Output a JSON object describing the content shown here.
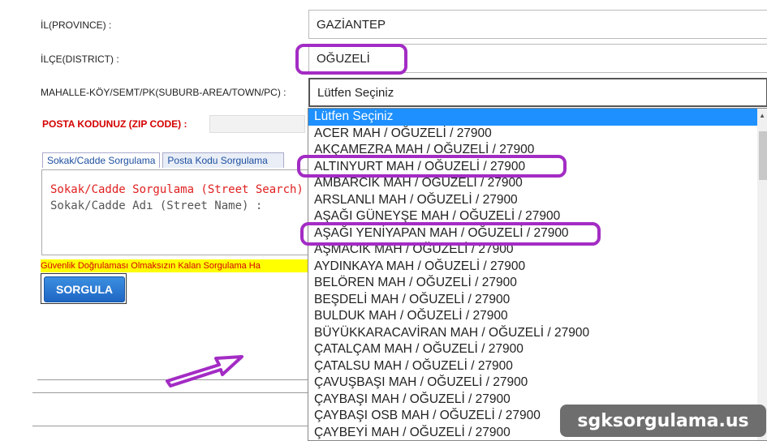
{
  "form": {
    "province_label": "İL(PROVINCE) :",
    "province_value": "GAZİANTEP",
    "district_label": "İLÇE(DISTRICT) :",
    "district_value": "OĞUZELİ",
    "suburb_label": "MAHALLE-KÖY/SEMT/PK(SUBURB-AREA/TOWN/PC) :",
    "suburb_value": "Lütfen Seçiniz",
    "zip_label": "POSTA KODUNUZ (ZIP CODE) :"
  },
  "tabs": [
    {
      "label": "Sokak/Cadde Sorgulama"
    },
    {
      "label": "Posta Kodu Sorgulama"
    }
  ],
  "panel": {
    "title": "Sokak/Cadde Sorgulama (Street Search)",
    "field_label": "Sokak/Cadde Adı (Street Name) :"
  },
  "warning_text": "Güvenlik Doğrulaması Olmaksızın Kalan Sorgulama Ha",
  "button_label": "SORGULA",
  "dropdown": {
    "options": [
      "Lütfen Seçiniz",
      "ACER MAH / OĞUZELİ / 27900",
      "AKÇAMEZRA MAH / OĞUZELİ / 27900",
      "ALTINYURT MAH / OĞUZELİ / 27900",
      "AMBARCIK MAH / OĞUZELİ / 27900",
      "ARSLANLI MAH / OĞUZELİ / 27900",
      "AŞAĞI GÜNEYŞE MAH / OĞUZELİ / 27900",
      "AŞAĞI YENİYAPAN MAH / OĞUZELİ / 27900",
      "AŞMACIK MAH / OĞUZELİ / 27900",
      "AYDINKAYA MAH / OĞUZELİ / 27900",
      "BELÖREN MAH / OĞUZELİ / 27900",
      "BEŞDELİ MAH / OĞUZELİ / 27900",
      "BULDUK MAH / OĞUZELİ / 27900",
      "BÜYÜKKARACAVİRAN MAH / OĞUZELİ / 27900",
      "ÇATALÇAM MAH / OĞUZELİ / 27900",
      "ÇATALSU MAH / OĞUZELİ / 27900",
      "ÇAVUŞBAŞI MAH / OĞUZELİ / 27900",
      "ÇAYBAŞI MAH / OĞUZELİ / 27900",
      "ÇAYBAŞI OSB MAH / OĞUZELİ / 27900",
      "ÇAYBEYİ MAH / OĞUZELİ / 27900"
    ]
  },
  "watermark": "sgksorgulama.us",
  "colors": {
    "highlight": "#a32cc4",
    "selected_option": "#1e90ff",
    "zip_label": "#d40000",
    "warning_bg": "#ffff00",
    "button": "#1e66c4"
  }
}
